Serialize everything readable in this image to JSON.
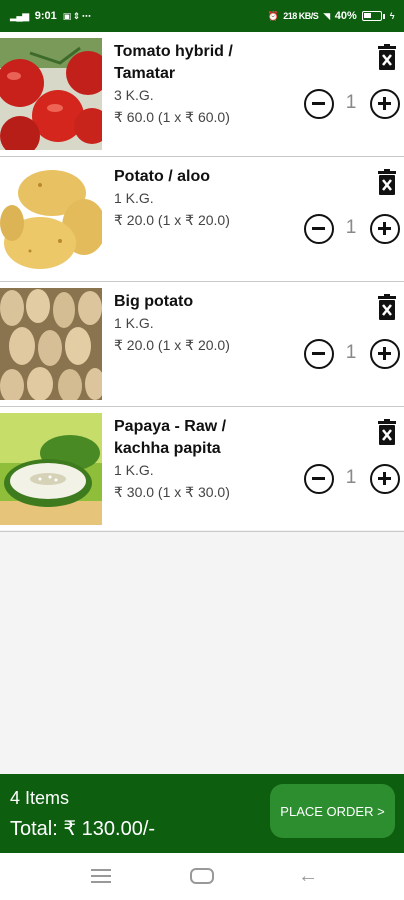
{
  "status_bar": {
    "time": "9:01",
    "network_info": "218 KB/S",
    "battery": "40%"
  },
  "cart": {
    "items": [
      {
        "name": "Tomato hybrid / Tamatar",
        "weight": "3 K.G.",
        "price": "₹ 60.0 (1 x ₹ 60.0)",
        "quantity": "1"
      },
      {
        "name": "Potato / aloo",
        "weight": "1 K.G.",
        "price": "₹ 20.0 (1 x ₹ 20.0)",
        "quantity": "1"
      },
      {
        "name": "Big potato",
        "weight": "1 K.G.",
        "price": "₹ 20.0 (1 x ₹ 20.0)",
        "quantity": "1"
      },
      {
        "name": "Papaya - Raw / kachha papita",
        "weight": "1 K.G.",
        "price": "₹ 30.0 (1 x ₹ 30.0)",
        "quantity": "1"
      }
    ]
  },
  "summary": {
    "items_count": "4 Items",
    "total": "Total: ₹ 130.00/-",
    "place_order_label": "PLACE ORDER >"
  },
  "colors": {
    "primary_green": "#0d5e0f",
    "button_green": "#2d8e2f"
  }
}
